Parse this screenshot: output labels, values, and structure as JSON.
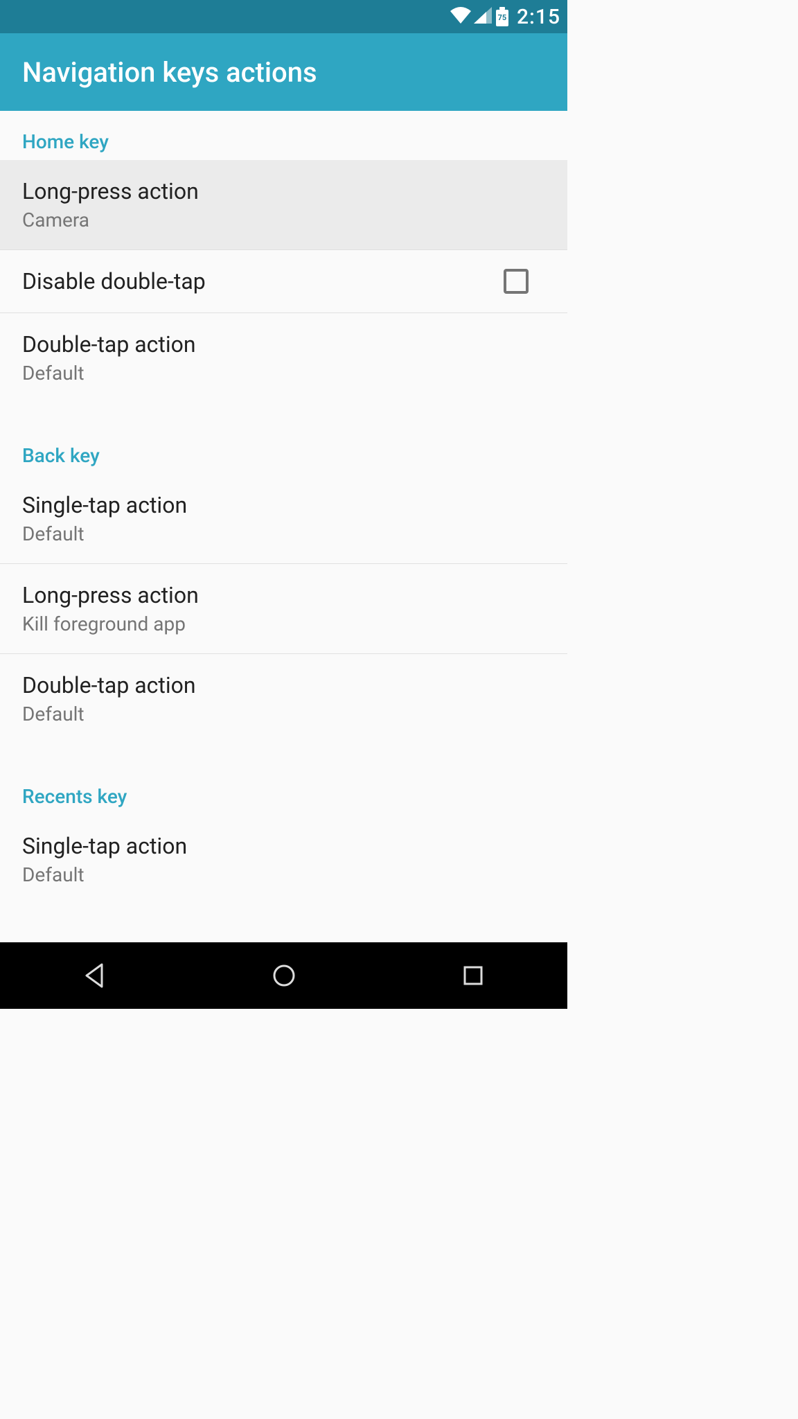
{
  "status": {
    "battery": "75",
    "time": "2:15"
  },
  "appbar": {
    "title": "Navigation keys actions"
  },
  "sections": {
    "home": {
      "label": "Home key",
      "longpress": {
        "title": "Long-press action",
        "value": "Camera"
      },
      "disable_doubletap": {
        "title": "Disable double-tap",
        "checked": false
      },
      "doubletap": {
        "title": "Double-tap action",
        "value": "Default"
      }
    },
    "back": {
      "label": "Back key",
      "singletap": {
        "title": "Single-tap action",
        "value": "Default"
      },
      "longpress": {
        "title": "Long-press action",
        "value": "Kill foreground app"
      },
      "doubletap": {
        "title": "Double-tap action",
        "value": "Default"
      }
    },
    "recents": {
      "label": "Recents key",
      "singletap": {
        "title": "Single-tap action",
        "value": "Default"
      }
    }
  }
}
